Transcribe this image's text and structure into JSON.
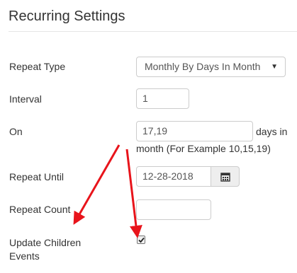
{
  "header": {
    "title": "Recurring Settings"
  },
  "form": {
    "repeat_type": {
      "label": "Repeat Type",
      "selected": "Monthly By Days In Month"
    },
    "interval": {
      "label": "Interval",
      "value": "1"
    },
    "on": {
      "label": "On",
      "value": "17,19",
      "help_line1": "days in",
      "help_line2": "month (For Example 10,15,19)"
    },
    "repeat_until": {
      "label": "Repeat Until",
      "value": "12-28-2018"
    },
    "repeat_count": {
      "label": "Repeat Count",
      "value": ""
    },
    "update_children": {
      "label_line1": "Update Children",
      "label_line2": "Events",
      "checked": true
    }
  },
  "annotations": {
    "arrow_color": "#e8141b"
  }
}
